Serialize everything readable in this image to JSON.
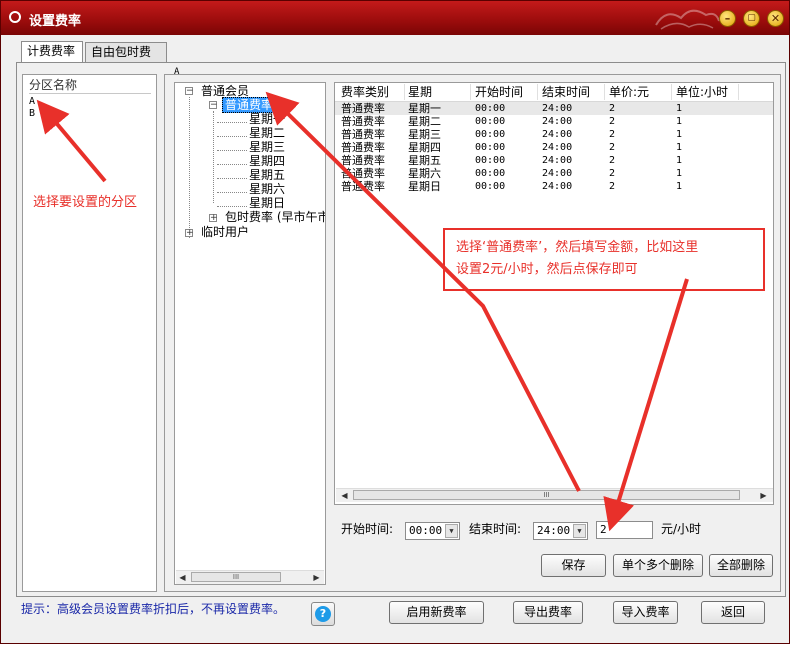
{
  "window": {
    "title": "设置费率"
  },
  "tabs": [
    {
      "label": "计费费率"
    },
    {
      "label": "自由包时费率"
    }
  ],
  "zones": {
    "header": "分区名称",
    "items": [
      "A",
      "B"
    ]
  },
  "selected_zone_label": "A",
  "tree": {
    "root1": "普通会员",
    "child_selected": "普通费率",
    "days": [
      "星期一",
      "星期二",
      "星期三",
      "星期四",
      "星期五",
      "星期六",
      "星期日"
    ],
    "package_node": "包时费率 (早市午市",
    "root2": "临时用户"
  },
  "grid": {
    "columns": [
      "费率类别",
      "星期",
      "开始时间",
      "结束时间",
      "单价:元",
      "单位:小时"
    ],
    "rows": [
      [
        "普通费率",
        "星期一",
        "00:00",
        "24:00",
        "2",
        "1"
      ],
      [
        "普通费率",
        "星期二",
        "00:00",
        "24:00",
        "2",
        "1"
      ],
      [
        "普通费率",
        "星期三",
        "00:00",
        "24:00",
        "2",
        "1"
      ],
      [
        "普通费率",
        "星期四",
        "00:00",
        "24:00",
        "2",
        "1"
      ],
      [
        "普通费率",
        "星期五",
        "00:00",
        "24:00",
        "2",
        "1"
      ],
      [
        "普通费率",
        "星期六",
        "00:00",
        "24:00",
        "2",
        "1"
      ],
      [
        "普通费率",
        "星期日",
        "00:00",
        "24:00",
        "2",
        "1"
      ]
    ]
  },
  "form": {
    "start_label": "开始时间:",
    "start_value": "00:00",
    "end_label": "结束时间:",
    "end_value": "24:00",
    "price_value": "2",
    "unit_label": "元/小时"
  },
  "buttons": {
    "save": "保存",
    "delete_some": "单个多个删除",
    "delete_all": "全部删除",
    "enable_new": "启用新费率",
    "export": "导出费率",
    "import": "导入费率",
    "back": "返回"
  },
  "hint": "提示：高级会员设置费率折扣后，不再设置费率。",
  "scroll_thumb": "III",
  "annotations": {
    "zone_tip": "选择要设置的分区",
    "main_tip_line1": "选择‘普通费率’，然后填写金额，比如这里",
    "main_tip_line2": "设置2元/小时，然后点保存即可"
  },
  "colors": {
    "title_bar": "#a81010",
    "annotation": "#e8302a",
    "selection": "#3399ff",
    "hint": "#1a28a8"
  }
}
